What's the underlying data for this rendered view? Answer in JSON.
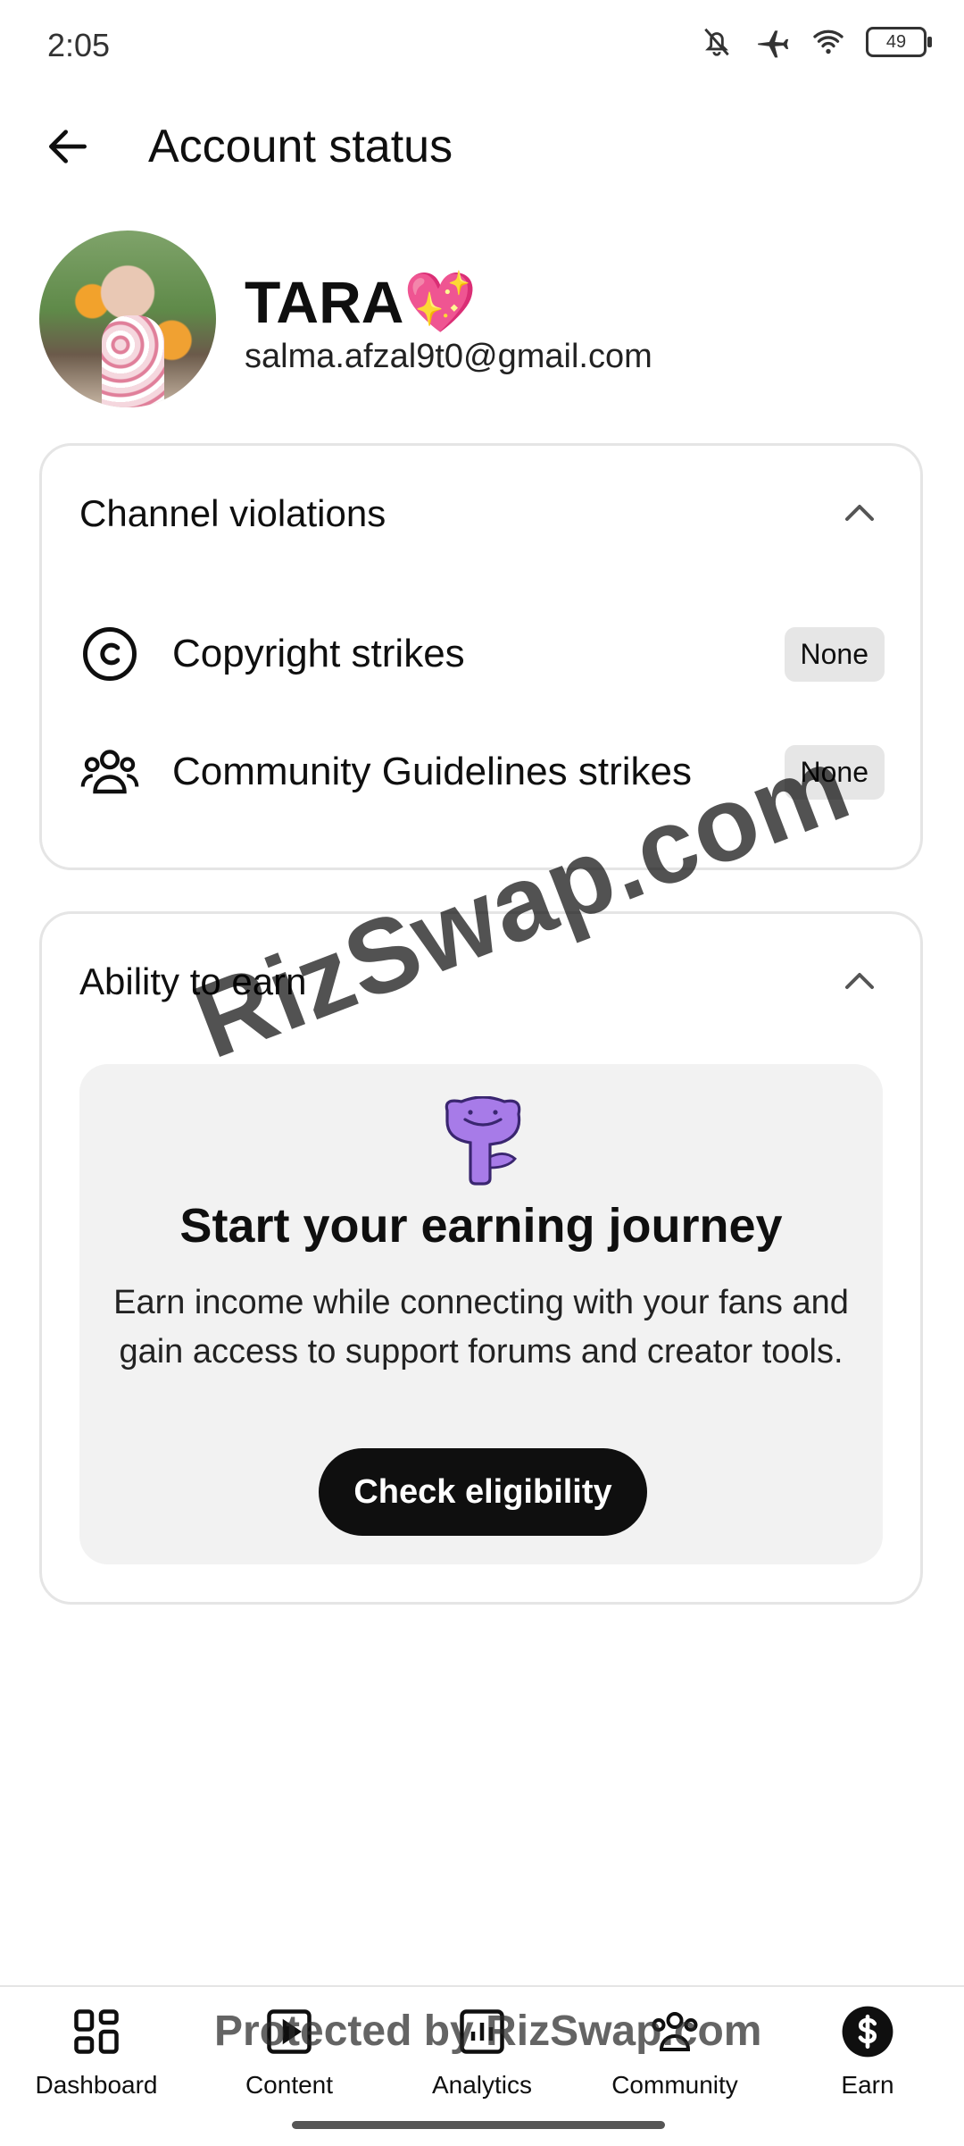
{
  "status_bar": {
    "time": "2:05",
    "battery": "49"
  },
  "header": {
    "title": "Account status"
  },
  "profile": {
    "name": "TARA💖",
    "email": "salma.afzal9t0@gmail.com"
  },
  "violations": {
    "title": "Channel violations",
    "rows": [
      {
        "label": "Copyright strikes",
        "status": "None"
      },
      {
        "label": "Community Guidelines strikes",
        "status": "None"
      }
    ]
  },
  "earn": {
    "title": "Ability to earn",
    "heading": "Start your earning journey",
    "body": "Earn income while connecting with your fans and gain access to support forums and creator tools.",
    "cta": "Check eligibility"
  },
  "watermark": {
    "text": "RizSwap.com",
    "nav_text": "Protected by RizSwap.com"
  },
  "bottom_nav": {
    "items": [
      {
        "label": "Dashboard",
        "icon": "dashboard-icon"
      },
      {
        "label": "Content",
        "icon": "content-icon"
      },
      {
        "label": "Analytics",
        "icon": "analytics-icon"
      },
      {
        "label": "Community",
        "icon": "community-icon"
      },
      {
        "label": "Earn",
        "icon": "earn-icon",
        "active": true
      }
    ]
  }
}
